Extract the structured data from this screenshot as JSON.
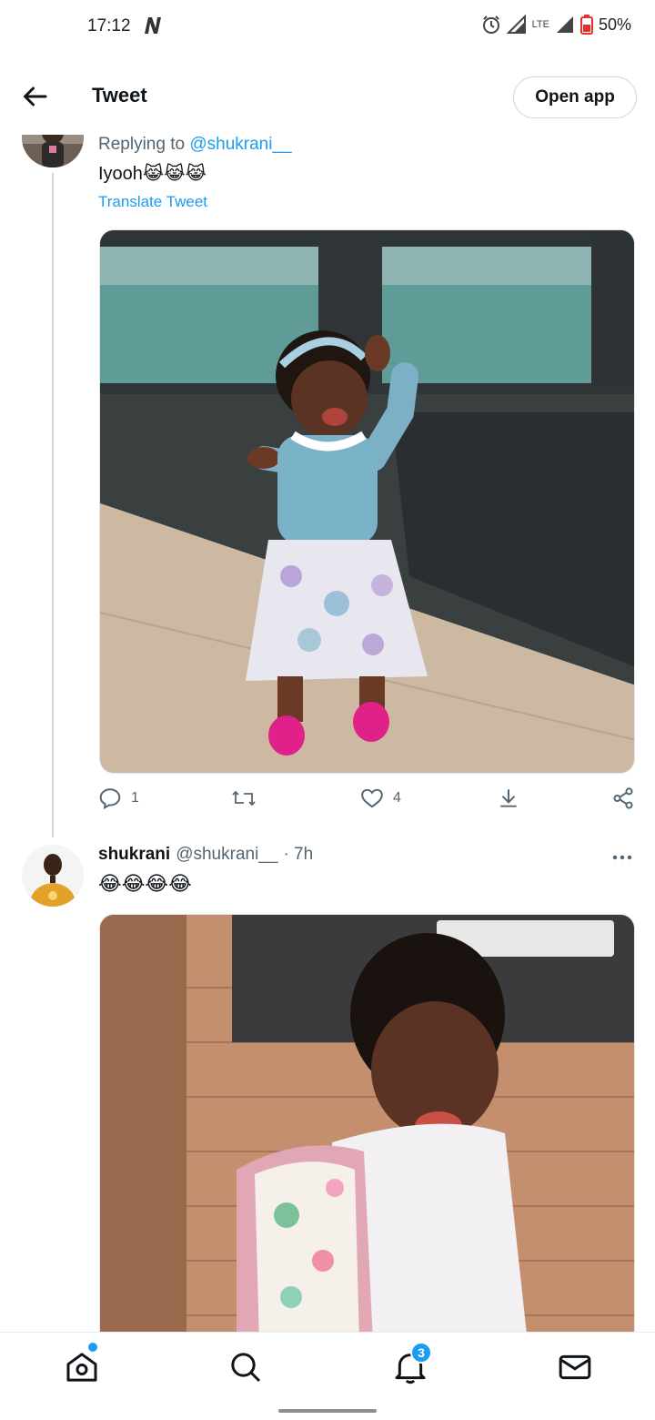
{
  "status_bar": {
    "time": "17:12",
    "network": "LTE",
    "battery": "50%"
  },
  "header": {
    "title": "Tweet",
    "open_app_label": "Open app"
  },
  "reply_tweet": {
    "replying_prefix": "Replying to ",
    "replying_to": "@shukrani__",
    "text": "Iyooh😹😹😹",
    "translate_label": "Translate Tweet",
    "replies": "1",
    "likes": "4"
  },
  "tweet": {
    "name": "shukrani",
    "handle": "@shukrani__",
    "time": "· 7h",
    "text": "😂😂😂😂"
  },
  "bottom_nav": {
    "notifications_badge": "3"
  },
  "colors": {
    "accent": "#1d9bf0",
    "secondary_text": "#536471",
    "border": "#cfd9de"
  },
  "icons": [
    "back-arrow-icon",
    "reply-icon",
    "retweet-icon",
    "heart-icon",
    "download-icon",
    "share-icon",
    "more-icon",
    "home-icon",
    "search-icon",
    "bell-icon",
    "mail-icon"
  ]
}
